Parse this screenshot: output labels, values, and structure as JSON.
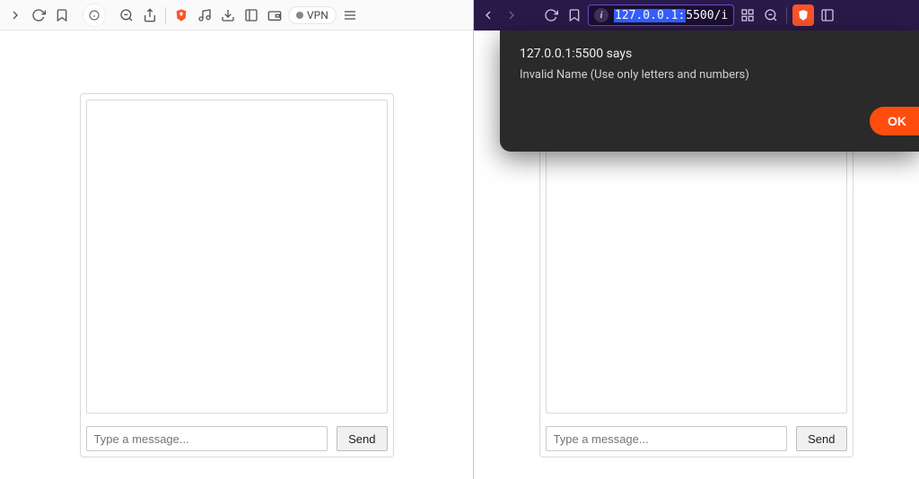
{
  "left": {
    "toolbar": {
      "vpn_label": "VPN"
    },
    "chat": {
      "message_placeholder": "Type a message...",
      "send_label": "Send"
    }
  },
  "right": {
    "toolbar": {
      "address": "127.0.0.1:5500/i",
      "address_selected": "127.0.0.1:",
      "address_rest": "5500/i"
    },
    "dialog": {
      "title": "127.0.0.1:5500 says",
      "message": "Invalid Name (Use only letters and numbers)",
      "ok_label": "OK"
    },
    "chat": {
      "message_placeholder": "Type a message...",
      "send_label": "Send"
    }
  }
}
